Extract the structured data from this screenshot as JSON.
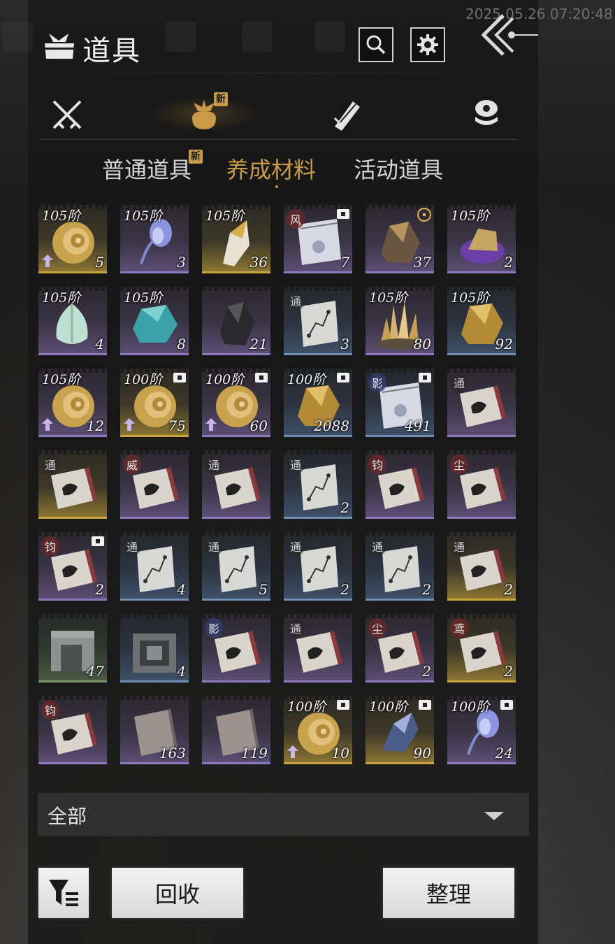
{
  "header": {
    "title": "道具",
    "timestamp": "2025.05.26 07:20:48"
  },
  "category_tabs": [
    {
      "name": "weapons",
      "new": false
    },
    {
      "name": "materials-bag",
      "new": true,
      "new_label": "新",
      "active": true
    },
    {
      "name": "scroll",
      "new": false
    },
    {
      "name": "currency",
      "new": false
    }
  ],
  "sub_tabs": [
    {
      "label": "普通道具",
      "new_label": "新",
      "active": false
    },
    {
      "label": "养成材料",
      "active": true
    },
    {
      "label": "活动道具",
      "active": false
    }
  ],
  "items": [
    {
      "tier": "105阶",
      "count": "5",
      "rarity": "gold",
      "art": "shell-icon",
      "up": true
    },
    {
      "tier": "105阶",
      "count": "3",
      "rarity": "purple",
      "art": "flower-icon"
    },
    {
      "tier": "105阶",
      "count": "36",
      "rarity": "gold",
      "art": "crystal-icon"
    },
    {
      "seal": "风",
      "count": "7",
      "rarity": "purple",
      "art": "envelope-icon",
      "lock": true
    },
    {
      "count": "37",
      "rarity": "purple",
      "art": "ore-icon",
      "target": true
    },
    {
      "tier": "105阶",
      "count": "2",
      "rarity": "purple",
      "art": "amethyst-icon"
    },
    {
      "tier": "105阶",
      "count": "4",
      "rarity": "purple",
      "art": "jade-bud-icon"
    },
    {
      "tier": "105阶",
      "count": "8",
      "rarity": "purple",
      "art": "turquoise-icon"
    },
    {
      "count": "21",
      "rarity": "purple",
      "art": "black-stone-icon"
    },
    {
      "seal": "通",
      "count": "3",
      "rarity": "blue",
      "art": "manual-icon"
    },
    {
      "tier": "105阶",
      "count": "80",
      "rarity": "purple",
      "art": "crystal-cluster-icon"
    },
    {
      "tier": "105阶",
      "count": "92",
      "rarity": "blue",
      "art": "gold-ore-icon"
    },
    {
      "tier": "105阶",
      "count": "12",
      "rarity": "purple",
      "art": "shell-icon",
      "up": true
    },
    {
      "tier": "100阶",
      "count": "75",
      "rarity": "gold",
      "art": "shell-icon",
      "lock": true,
      "up": true
    },
    {
      "tier": "100阶",
      "count": "60",
      "rarity": "purple",
      "art": "shell-icon",
      "lock": true,
      "up": true
    },
    {
      "tier": "100阶",
      "count": "2088",
      "rarity": "blue",
      "art": "gold-ore-icon",
      "lock": true
    },
    {
      "seal": "影",
      "count": "491",
      "rarity": "blue",
      "art": "envelope-icon",
      "lock": true
    },
    {
      "seal": "通",
      "count": "",
      "rarity": "purple",
      "art": "book-icon"
    },
    {
      "seal": "通",
      "count": "",
      "rarity": "gold",
      "art": "book-icon"
    },
    {
      "seal": "威",
      "count": "",
      "rarity": "purple",
      "art": "book-icon"
    },
    {
      "seal": "通",
      "count": "",
      "rarity": "purple",
      "art": "book-icon"
    },
    {
      "seal": "通",
      "count": "2",
      "rarity": "blue",
      "art": "manual-icon"
    },
    {
      "seal": "钧",
      "count": "",
      "rarity": "purple",
      "art": "book-icon"
    },
    {
      "seal": "尘",
      "count": "",
      "rarity": "purple",
      "art": "book-icon"
    },
    {
      "seal": "钧",
      "count": "2",
      "rarity": "purple",
      "art": "book-icon",
      "lock": true
    },
    {
      "seal": "通",
      "count": "4",
      "rarity": "blue",
      "art": "manual-icon"
    },
    {
      "seal": "通",
      "count": "5",
      "rarity": "blue",
      "art": "manual-icon"
    },
    {
      "seal": "通",
      "count": "2",
      "rarity": "blue",
      "art": "manual-icon"
    },
    {
      "seal": "通",
      "count": "2",
      "rarity": "blue",
      "art": "manual-icon"
    },
    {
      "seal": "通",
      "count": "2",
      "rarity": "gold",
      "art": "book-icon"
    },
    {
      "count": "47",
      "rarity": "green",
      "art": "stone-block-icon"
    },
    {
      "count": "4",
      "rarity": "blue",
      "art": "carved-block-icon"
    },
    {
      "seal": "影",
      "count": "",
      "rarity": "purple",
      "art": "book-icon"
    },
    {
      "seal": "通",
      "count": "",
      "rarity": "purple",
      "art": "book-icon"
    },
    {
      "seal": "尘",
      "count": "2",
      "rarity": "purple",
      "art": "book-icon"
    },
    {
      "seal": "鸢",
      "count": "2",
      "rarity": "gold",
      "art": "book-icon"
    },
    {
      "seal": "钧",
      "count": "",
      "rarity": "purple",
      "art": "book-icon"
    },
    {
      "count": "163",
      "rarity": "purple",
      "art": "plain-book-icon"
    },
    {
      "count": "119",
      "rarity": "purple",
      "art": "plain-book-icon"
    },
    {
      "tier": "100阶",
      "count": "10",
      "rarity": "gold",
      "art": "shell-icon",
      "lock": true,
      "up": true
    },
    {
      "tier": "100阶",
      "count": "90",
      "rarity": "gold",
      "art": "meteor-icon",
      "lock": true
    },
    {
      "tier": "100阶",
      "count": "24",
      "rarity": "purple",
      "art": "flower-icon",
      "lock": true
    }
  ],
  "filter": {
    "selected": "全部"
  },
  "buttons": {
    "recycle": "回收",
    "sort": "整理"
  },
  "colors": {
    "accent": "#c99a48",
    "purple_rarity": "#8c78bb",
    "gold_rarity": "#c9a33e",
    "blue_rarity": "#6f8fb3"
  }
}
